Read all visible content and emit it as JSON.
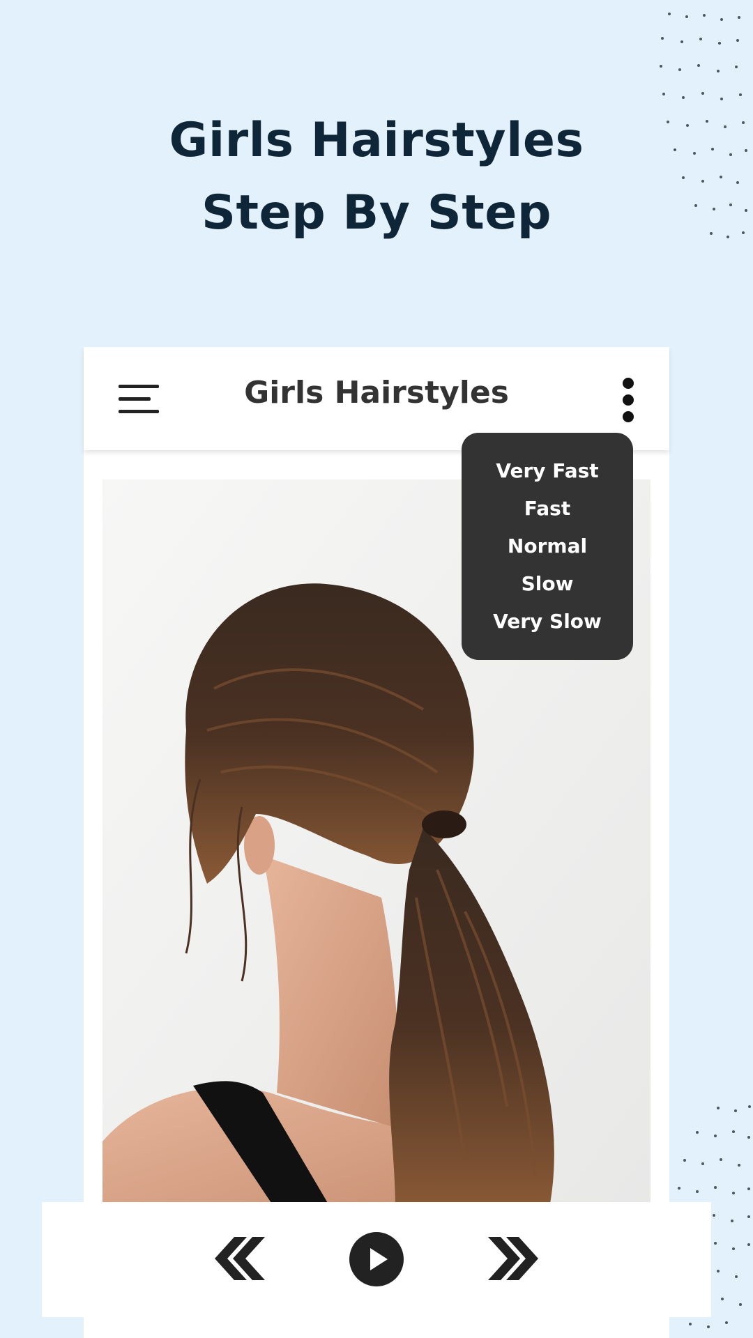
{
  "promo": {
    "title_line1": "Girls Hairstyles",
    "title_line2": "Step By Step"
  },
  "appbar": {
    "title": "Girls Hairstyles",
    "menu_icon": "hamburger-menu-icon",
    "more_icon": "more-vertical-icon"
  },
  "speed_menu": {
    "items": [
      "Very Fast",
      "Fast",
      "Normal",
      "Slow",
      "Very Slow"
    ]
  },
  "controls": {
    "previous_icon": "double-chevron-left-icon",
    "play_icon": "play-circle-icon",
    "next_icon": "double-chevron-right-icon"
  },
  "colors": {
    "background": "#e3f1fc",
    "title": "#0f2638",
    "menu_bg": "#333333",
    "icon": "#222222"
  }
}
